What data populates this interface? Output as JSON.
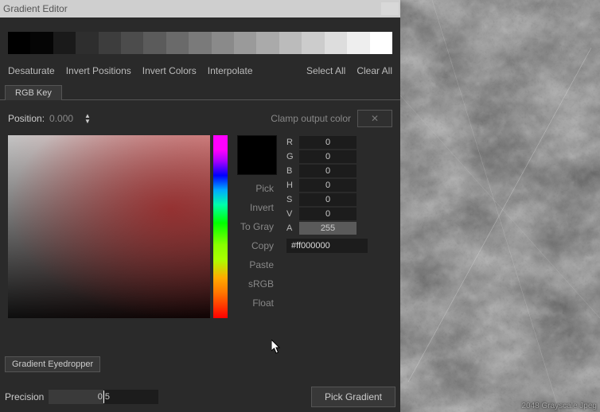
{
  "window": {
    "title": "Gradient Editor"
  },
  "gradient_stops": [
    "#000000",
    "#050505",
    "#1a1a1a",
    "#2e2e2e",
    "#3d3d3d",
    "#4c4c4c",
    "#5b5b5b",
    "#6a6a6a",
    "#7a7a7a",
    "#8a8a8a",
    "#9a9a9a",
    "#aaaaaa",
    "#bbbbbb",
    "#cccccc",
    "#dddddd",
    "#eeeeee",
    "#ffffff"
  ],
  "actions": {
    "desaturate": "Desaturate",
    "invert_positions": "Invert Positions",
    "invert_colors": "Invert Colors",
    "interpolate": "Interpolate",
    "select_all": "Select All",
    "clear_all": "Clear All"
  },
  "tabs": {
    "rgb_key": "RGB Key"
  },
  "position": {
    "label": "Position:",
    "value": "0.000"
  },
  "clamp": {
    "label": "Clamp output color",
    "button": "✕"
  },
  "swatch_color": "#000000",
  "mid_actions": {
    "pick": "Pick",
    "invert": "Invert",
    "to_gray": "To Gray",
    "copy": "Copy",
    "paste": "Paste",
    "srgb": "sRGB",
    "float": "Float"
  },
  "channels": {
    "R": "0",
    "G": "0",
    "B": "0",
    "H": "0",
    "S": "0",
    "V": "0",
    "A": "255"
  },
  "hex": "#ff000000",
  "eyedropper": {
    "label": "Gradient Eyedropper"
  },
  "precision": {
    "label": "Precision",
    "display": "0.5",
    "fill_pct": 50
  },
  "pick_gradient": "Pick Gradient",
  "texture_footer": "2048 Grayscale Jpeg"
}
